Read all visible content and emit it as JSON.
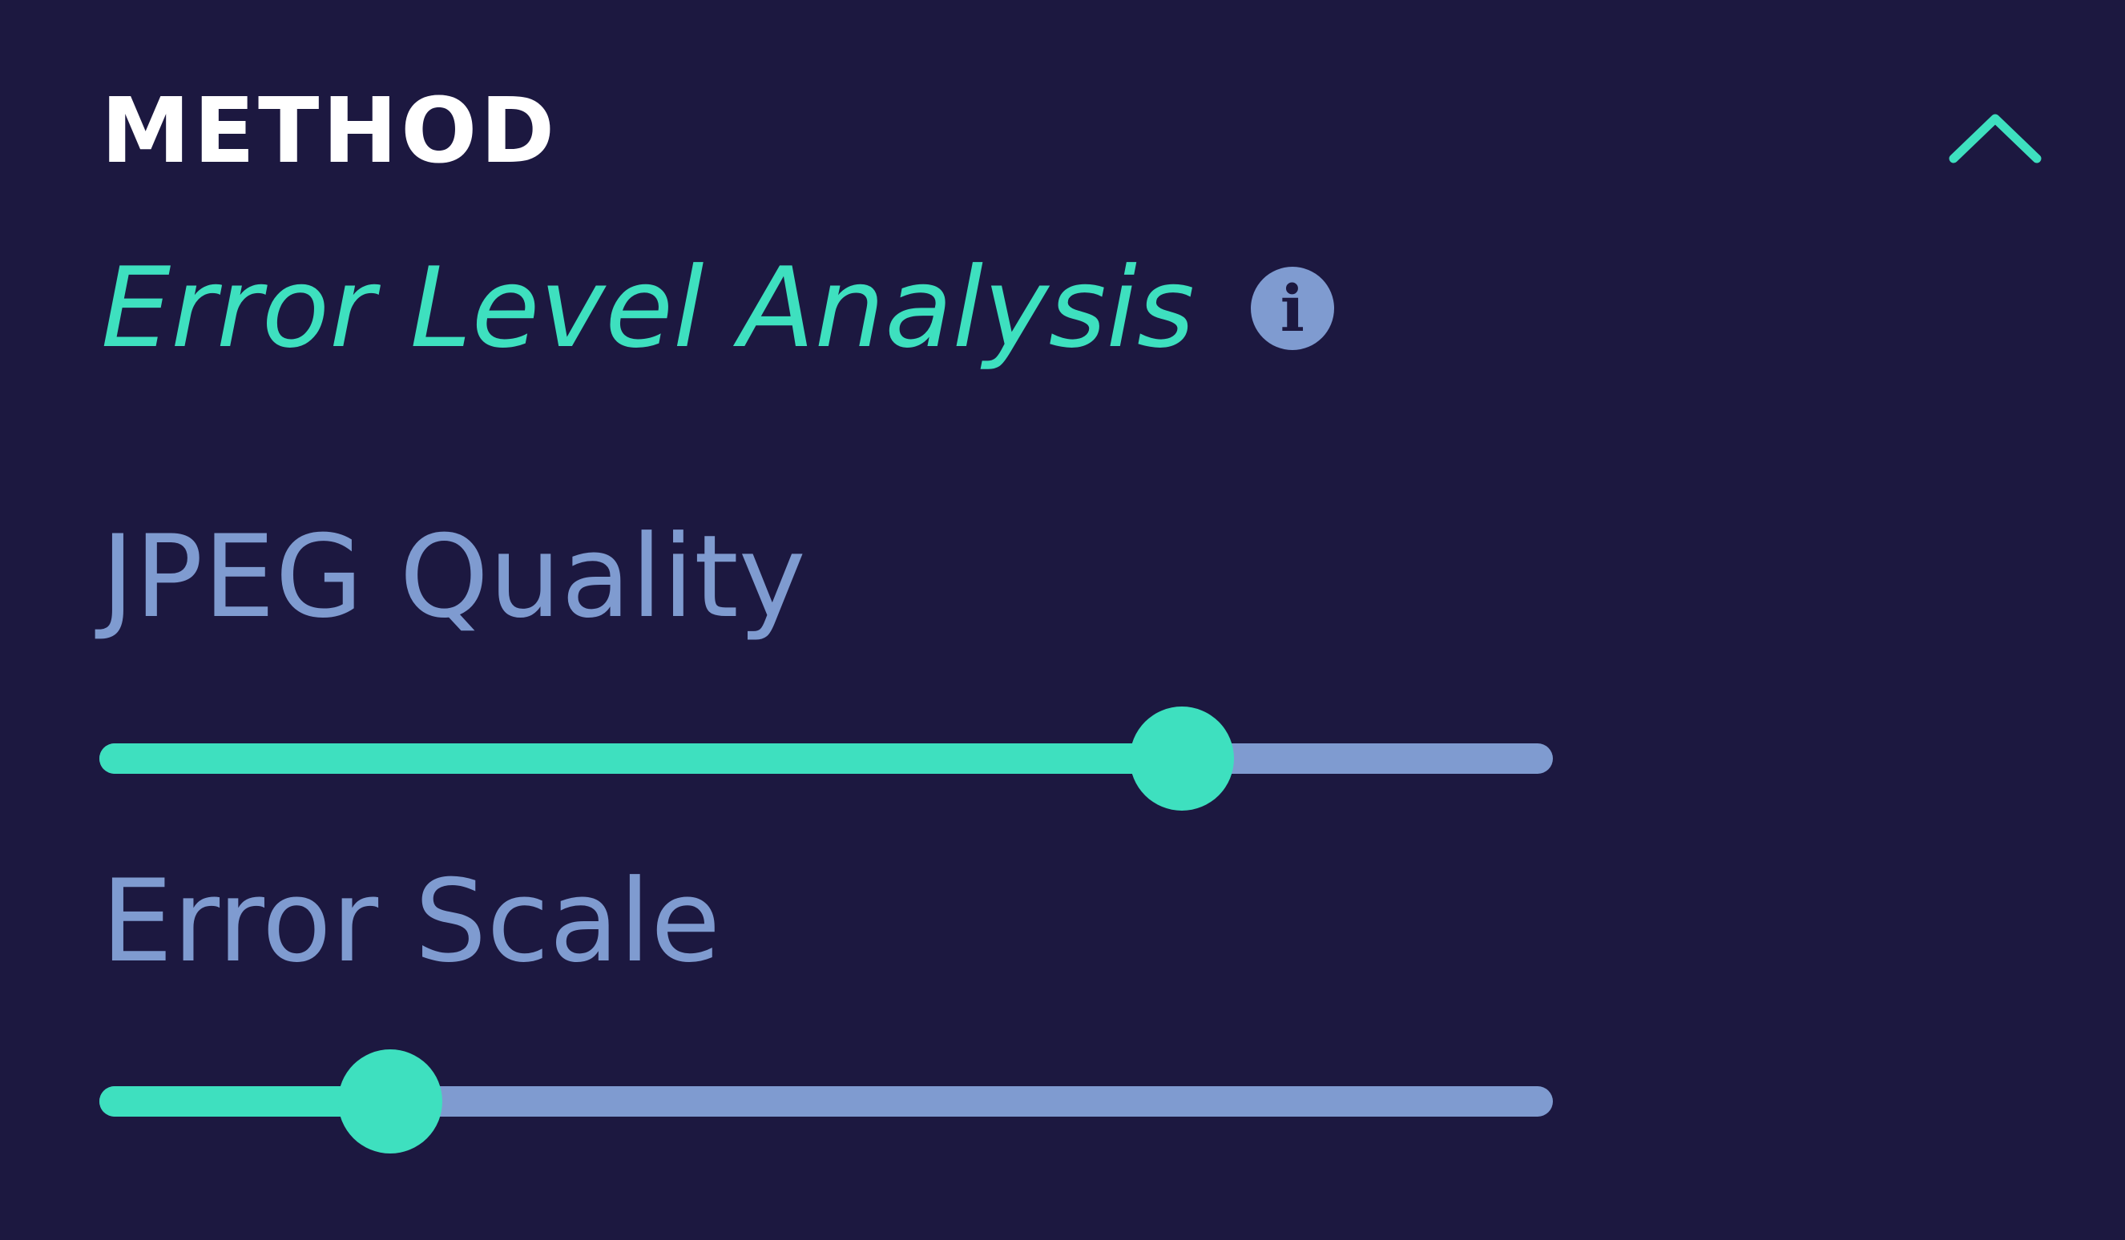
{
  "panel": {
    "title": "METHOD",
    "collapse_icon": "chevron-up-icon"
  },
  "method": {
    "name": "Error Level Analysis",
    "info_icon": "info-icon",
    "info_glyph": "i"
  },
  "params": {
    "jpeg_quality": {
      "label": "JPEG Quality",
      "fraction": 0.745
    },
    "error_scale": {
      "label": "Error Scale",
      "fraction": 0.2
    }
  },
  "colors": {
    "background": "#1c1840",
    "accent": "#3ee0bf",
    "muted": "#7f9bd0",
    "title": "#ffffff"
  }
}
